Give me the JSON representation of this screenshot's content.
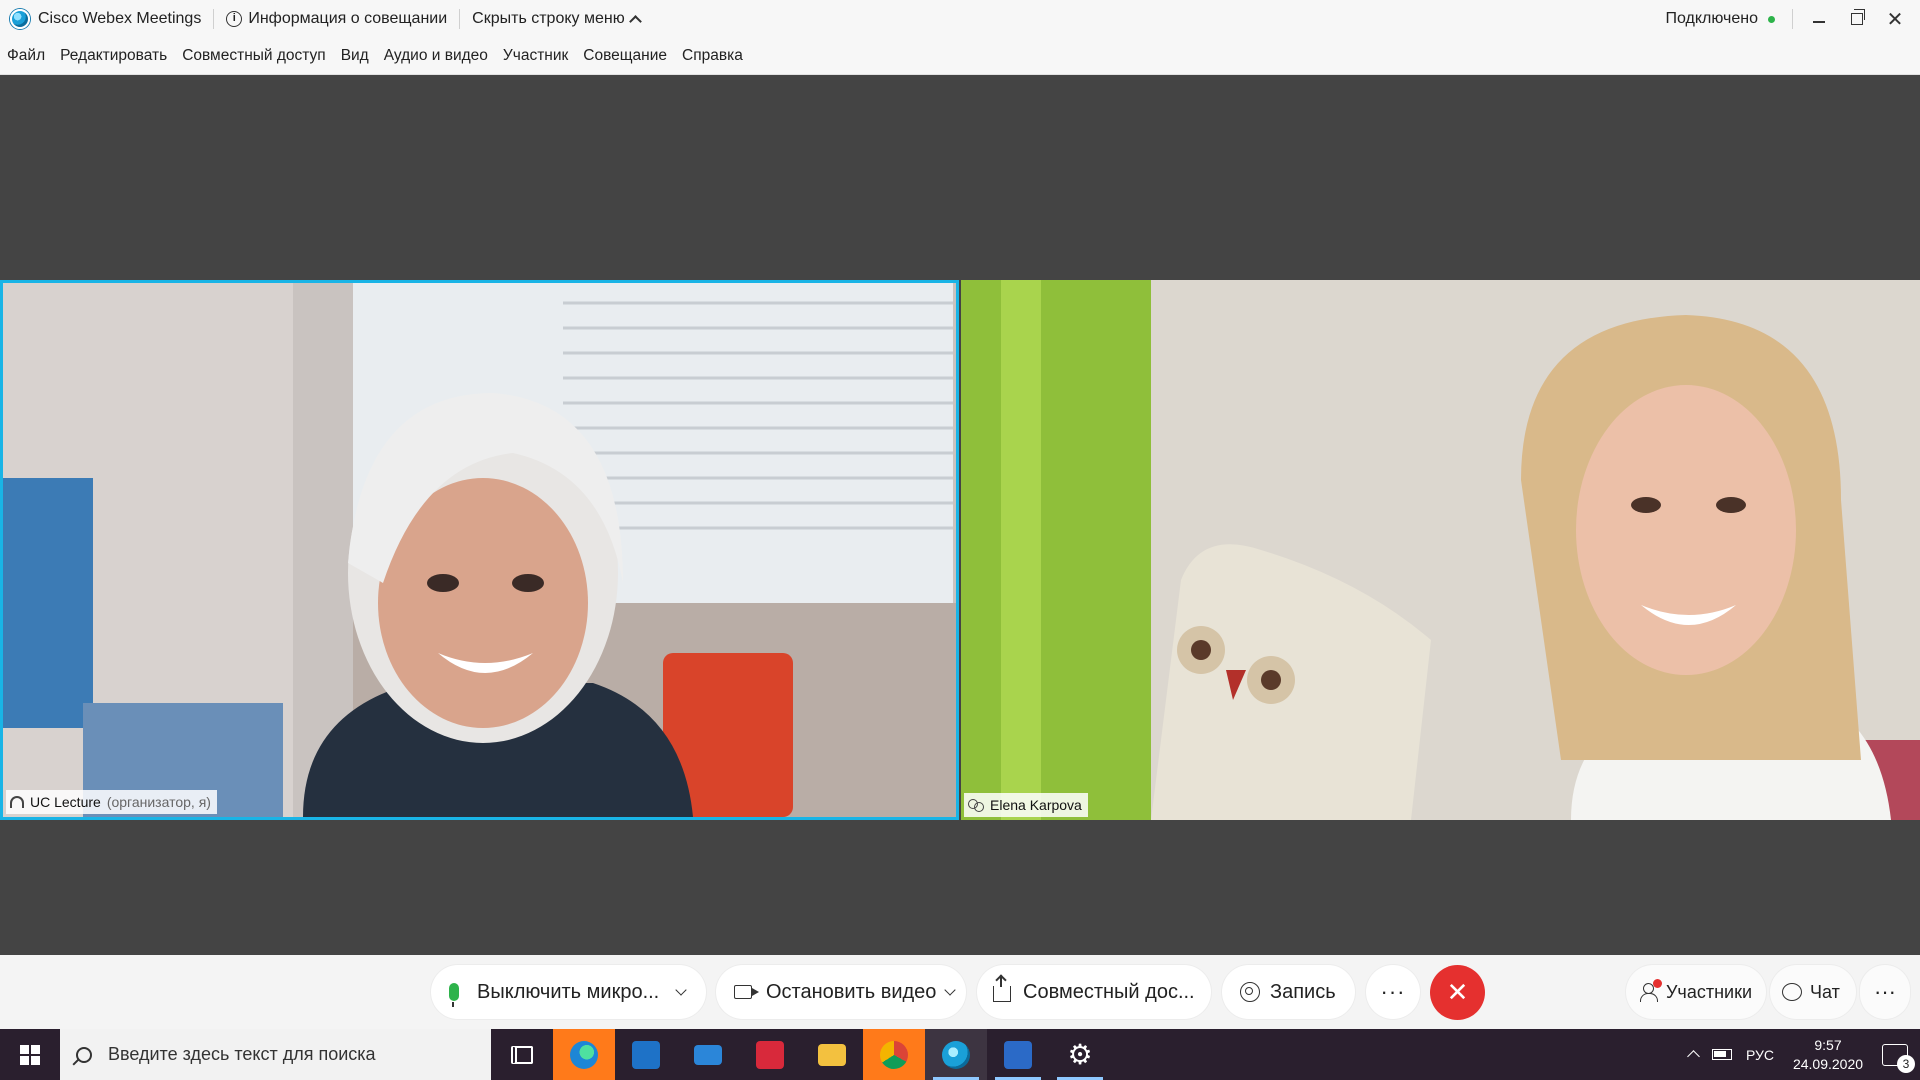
{
  "titlebar": {
    "app_title": "Cisco Webex Meetings",
    "meeting_info": "Информация о совещании",
    "hide_menu": "Скрыть строку меню",
    "status": "Подключено",
    "status_color": "#2db34a"
  },
  "menu": {
    "items": [
      "Файл",
      "Редактировать",
      "Совместный доступ",
      "Вид",
      "Аудио и видео",
      "Участник",
      "Совещание",
      "Справка"
    ]
  },
  "participants": [
    {
      "name": "UC Lecture",
      "role": "(организатор, я)",
      "active_speaker": true,
      "highlight_color": "#19b4e6"
    },
    {
      "name": "Elena Karpova",
      "role": "",
      "active_speaker": false
    }
  ],
  "controls": {
    "mute": "Выключить микро...",
    "video": "Остановить видео",
    "share": "Совместный дос...",
    "record": "Запись",
    "more": "···",
    "end": "✕",
    "end_color": "#e5302f",
    "participants": "Участники",
    "chat": "Чат",
    "more_right": "···"
  },
  "taskbar": {
    "search_placeholder": "Введите здесь текст для поиска",
    "apps": [
      "task-view",
      "edge",
      "store",
      "mail",
      "gift",
      "file-explorer",
      "chrome",
      "webex",
      "word",
      "settings"
    ],
    "language": "РУС",
    "time": "9:57",
    "date": "24.09.2020",
    "notification_count": "3"
  }
}
